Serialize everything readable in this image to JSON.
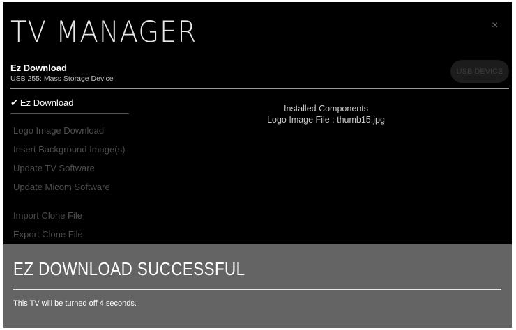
{
  "header": {
    "title": "TV MANAGER",
    "close_label": "×",
    "section_title": "Ez Download",
    "device_label": "USB 255: Mass Storage Device",
    "usb_button_label": "USB DEVICE"
  },
  "menu": {
    "active_check": "✔",
    "active_label": "Ez Download",
    "items": [
      {
        "label": "Logo Image Download"
      },
      {
        "label": "Insert Background Image(s)"
      },
      {
        "label": "Update TV Software"
      },
      {
        "label": "Update Micom Software"
      },
      {
        "label": "Import Clone File"
      },
      {
        "label": "Export Clone File"
      }
    ]
  },
  "content": {
    "heading": "Installed Components",
    "detail": "Logo Image File : thumb15.jpg"
  },
  "popup": {
    "title": "EZ DOWNLOAD SUCCESSFUL",
    "message": "This TV will be turned off 4 seconds."
  }
}
